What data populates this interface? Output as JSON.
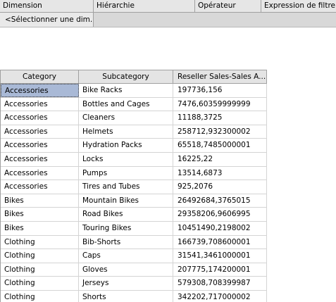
{
  "filter": {
    "columns": [
      "Dimension",
      "Hiérarchie",
      "Opérateur",
      "Expression de filtre"
    ],
    "dimension_placeholder": "<Sélectionner une dim..."
  },
  "grid": {
    "columns": [
      "Category",
      "Subcategory",
      "Reseller Sales-Sales A..."
    ],
    "rows": [
      [
        "Accessories",
        "Bike Racks",
        "197736,156"
      ],
      [
        "Accessories",
        "Bottles and Cages",
        "7476,60359999999"
      ],
      [
        "Accessories",
        "Cleaners",
        "11188,3725"
      ],
      [
        "Accessories",
        "Helmets",
        "258712,932300002"
      ],
      [
        "Accessories",
        "Hydration Packs",
        "65518,7485000001"
      ],
      [
        "Accessories",
        "Locks",
        "16225,22"
      ],
      [
        "Accessories",
        "Pumps",
        "13514,6873"
      ],
      [
        "Accessories",
        "Tires and Tubes",
        "925,2076"
      ],
      [
        "Bikes",
        "Mountain Bikes",
        "26492684,3765015"
      ],
      [
        "Bikes",
        "Road Bikes",
        "29358206,9606995"
      ],
      [
        "Bikes",
        "Touring Bikes",
        "10451490,2198002"
      ],
      [
        "Clothing",
        "Bib-Shorts",
        "166739,708600001"
      ],
      [
        "Clothing",
        "Caps",
        "31541,3461000001"
      ],
      [
        "Clothing",
        "Gloves",
        "207775,174200001"
      ],
      [
        "Clothing",
        "Jerseys",
        "579308,708399987"
      ],
      [
        "Clothing",
        "Shorts",
        "342202,717000002"
      ]
    ]
  }
}
